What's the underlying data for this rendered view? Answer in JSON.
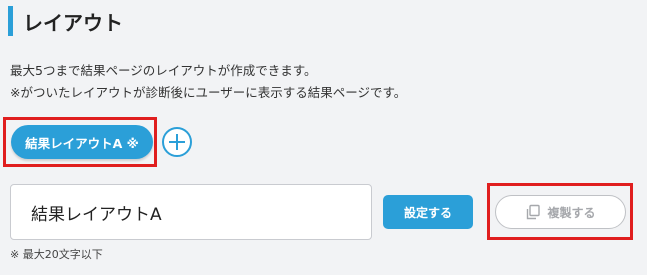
{
  "section": {
    "title": "レイアウト"
  },
  "description": {
    "line1": "最大5つまで結果ページのレイアウトが作成できます。",
    "line2": "※がついたレイアウトが診断後にユーザーに表示する結果ページです。"
  },
  "tabs": [
    {
      "label": "結果レイアウトA ※",
      "active": true
    }
  ],
  "add_button": {
    "icon": "plus-circle-icon"
  },
  "layout_name": {
    "value": "結果レイアウトA"
  },
  "actions": {
    "settings_label": "設定する",
    "copy_label": "複製する",
    "copy_icon": "copy-icon"
  },
  "note": "※ 最大20文字以下",
  "colors": {
    "accent": "#2b9fd8",
    "highlight": "#e01e1e",
    "disabled": "#a6a8ac"
  }
}
